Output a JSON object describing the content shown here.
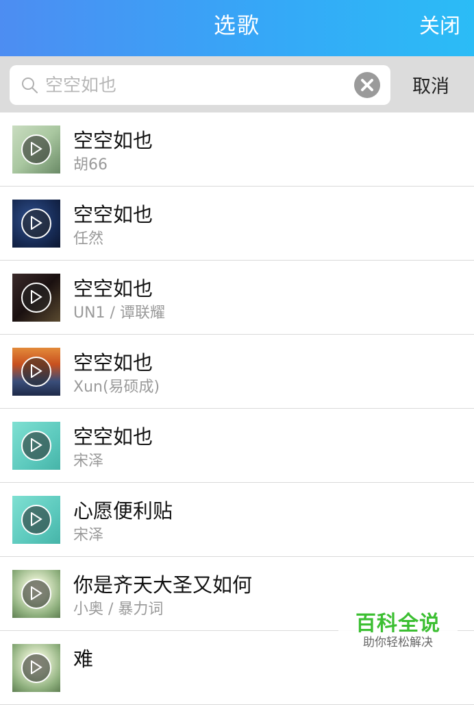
{
  "header": {
    "title": "选歌",
    "close_label": "关闭"
  },
  "search": {
    "value": "",
    "placeholder": "空空如也",
    "cancel_label": "取消"
  },
  "songs": [
    {
      "title": "空空如也",
      "artist": "胡66"
    },
    {
      "title": "空空如也",
      "artist": "任然"
    },
    {
      "title": "空空如也",
      "artist": "UN1 / 谭联耀"
    },
    {
      "title": "空空如也",
      "artist": "Xun(易硕成)"
    },
    {
      "title": "空空如也",
      "artist": "宋泽"
    },
    {
      "title": "心愿便利贴",
      "artist": "宋泽"
    },
    {
      "title": "你是齐天大圣又如何",
      "artist": "小奥 / 暴力词"
    },
    {
      "title": "难",
      "artist": ""
    }
  ],
  "watermark": {
    "main": "百科全说",
    "sub": "助你轻松解决"
  },
  "colors": {
    "header_start": "#4d8df2",
    "header_end": "#2bbcf6",
    "watermark_green": "#3cbf32"
  }
}
